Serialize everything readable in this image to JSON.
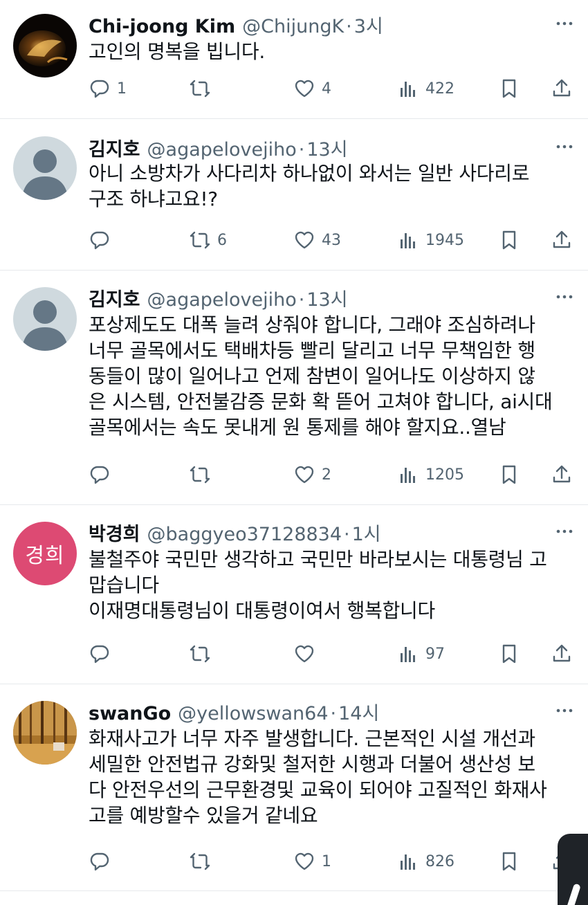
{
  "tweets": [
    {
      "name": "Chi-joong Kim",
      "handle": "@ChijungK",
      "dot": "·",
      "time": "3시",
      "text": "고인의 명복을 빕니다.",
      "replies": "1",
      "retweets": "",
      "likes": "4",
      "views": "422",
      "avatar": "photo-dark-gold"
    },
    {
      "name": "김지호",
      "handle": "@agapelovejiho",
      "dot": "·",
      "time": "13시",
      "text": "아니 소방차가 사다리차 하나없이 와서는 일반 사다리로\n구조 하냐고요!?",
      "replies": "",
      "retweets": "6",
      "likes": "43",
      "views": "1945",
      "avatar": "default-silhouette"
    },
    {
      "name": "김지호",
      "handle": "@agapelovejiho",
      "dot": "·",
      "time": "13시",
      "text": "포상제도도 대폭 늘려 상줘야 합니다, 그래야 조심하려나\n너무 골목에서도 택배차등 빨리 달리고 너무 무책임한 행\n동들이 많이 일어나고 언제 참변이 일어나도 이상하지 않\n은 시스템, 안전불감증 문화 확 뜯어 고쳐야 합니다, ai시대\n골목에서는 속도 못내게 원 통제를 해야 할지요..열남",
      "replies": "",
      "retweets": "",
      "likes": "2",
      "views": "1205",
      "avatar": "default-silhouette"
    },
    {
      "name": "박경희",
      "handle": "@baggyeo37128834",
      "dot": "·",
      "time": "1시",
      "text": "불철주야 국민만 생각하고 국민만 바라보시는 대통령님 고\n맙습니다\n이재명대통령님이 대통령이여서 행복합니다",
      "replies": "",
      "retweets": "",
      "likes": "",
      "views": "97",
      "avatar": "text-badge",
      "avatar_text": "경희",
      "avatar_color": "#dd4a73"
    },
    {
      "name": "swanGo",
      "handle": "@yellowswan64",
      "dot": "·",
      "time": "14시",
      "text": "화재사고가 너무 자주 발생합니다. 근본적인 시설 개선과\n세밀한 안전법규 강화및 철저한 시행과 더불어 생산성 보\n다 안전우선의 근무환경및 교육이 되어야 고질적인 화재사\n고를 예방할수 있을거 같네요",
      "replies": "",
      "retweets": "",
      "likes": "1",
      "views": "826",
      "avatar": "photo-autumn-forest"
    }
  ],
  "icons": {
    "reply": "reply-icon",
    "retweet": "retweet-icon",
    "like": "heart-icon",
    "views": "views-icon",
    "bookmark": "bookmark-icon",
    "share": "share-icon",
    "more": "more-icon"
  },
  "colors": {
    "text": "#0f1419",
    "secondary": "#536471",
    "divider": "#e6e9ec",
    "badge": "#dd4a73"
  }
}
